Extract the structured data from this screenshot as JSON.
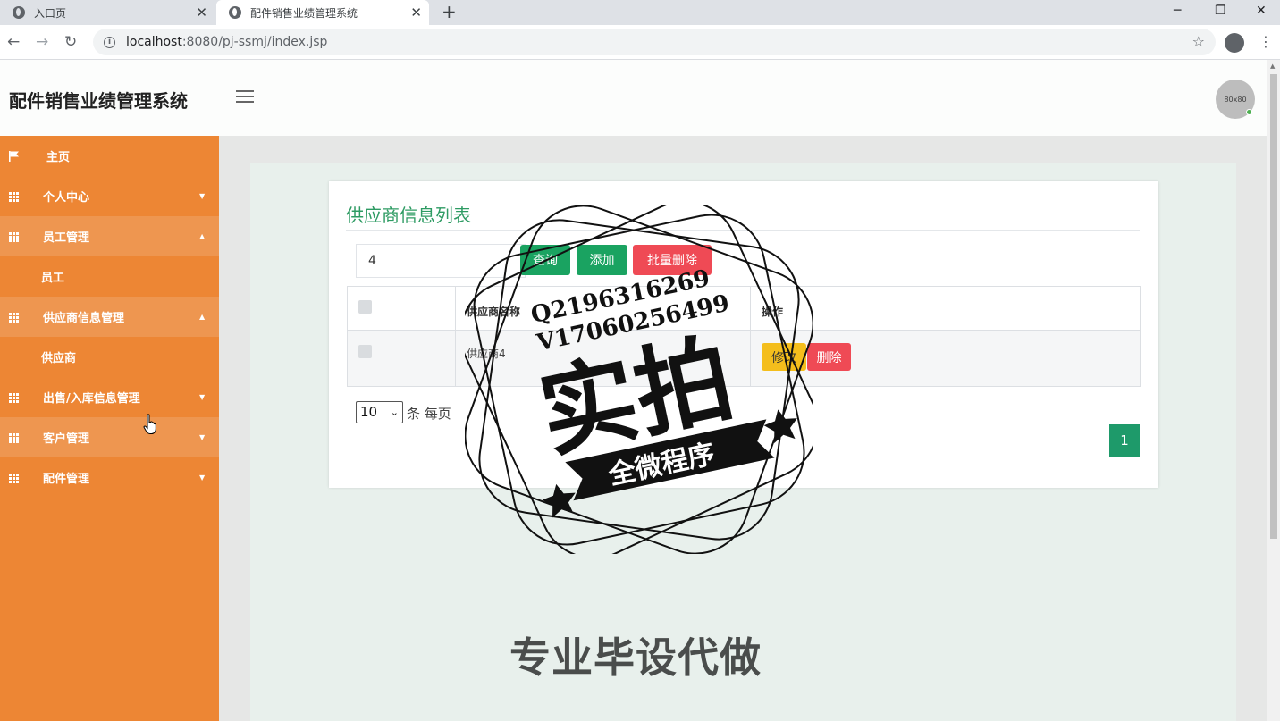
{
  "browser": {
    "tabs": [
      {
        "title": "入口页",
        "close": "✕"
      },
      {
        "title": "配件销售业绩管理系统",
        "close": "✕"
      }
    ],
    "new_tab": "+",
    "window_buttons": [
      "─",
      "❐",
      "✕"
    ],
    "url_host": "localhost",
    "url_path": ":8080/pj-ssmj/index.jsp",
    "nav": {
      "back": "←",
      "forward": "→",
      "reload": "↻"
    },
    "star": "☆",
    "menu": "⋮"
  },
  "header": {
    "title": "配件销售业绩管理系统",
    "avatar_text": "80x80"
  },
  "sidebar": {
    "items": [
      {
        "label": "主页",
        "icon": "flag-icon"
      },
      {
        "label": "个人中心",
        "icon": "grid-icon",
        "caret": "▼"
      },
      {
        "label": "员工管理",
        "icon": "grid-icon",
        "caret": "▲"
      },
      {
        "label": "员工",
        "sub": true
      },
      {
        "label": "供应商信息管理",
        "icon": "grid-icon",
        "caret": "▲"
      },
      {
        "label": "供应商",
        "sub": true
      },
      {
        "label": "出售/入库信息管理",
        "icon": "grid-icon",
        "caret": "▼"
      },
      {
        "label": "客户管理",
        "icon": "grid-icon",
        "caret": "▼"
      },
      {
        "label": "配件管理",
        "icon": "grid-icon",
        "caret": "▼"
      }
    ]
  },
  "main": {
    "card_title": "供应商信息列表",
    "search_value": "4",
    "buttons": {
      "query": "查询",
      "add": "添加",
      "batch_delete": "批量删除"
    },
    "table": {
      "headers": [
        "",
        "供应商名称",
        "操作"
      ],
      "rows": [
        {
          "name": "供应商4",
          "edit": "修改",
          "delete": "删除"
        }
      ]
    },
    "page_size": "10",
    "per_page_label": "条 每页",
    "current_page": "1"
  },
  "overlay": {
    "stamp_line1": "Q2196316269",
    "stamp_line2": "V17060256499",
    "stamp_main": "实拍",
    "stamp_ribbon": "全微程序",
    "banner": "专业毕设代做"
  }
}
